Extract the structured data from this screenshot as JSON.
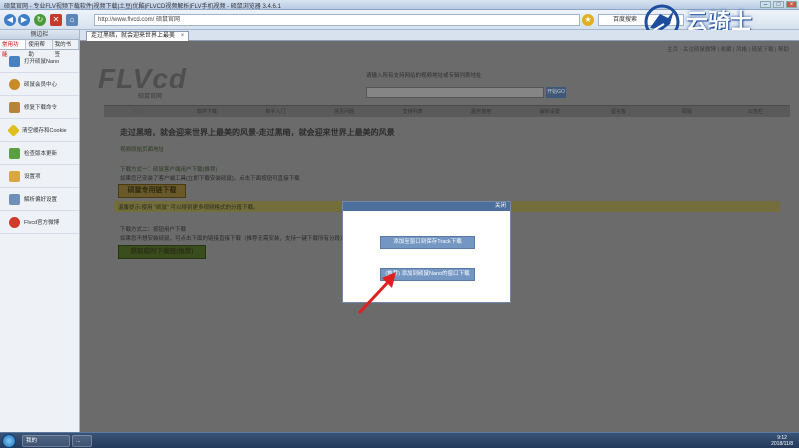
{
  "window": {
    "title": "硕鼠官网 - 专业FLV视频下载软件|视频下载|土豆|优酷|FLVCD视频解析|FLV手机视频 - 硕鼠浏览器 3.4.6.1",
    "controls": [
      "–",
      "□",
      "×"
    ]
  },
  "navbar": {
    "address": "http://www.flvcd.com/ 硕鼠官网",
    "search_label": "百度搜索"
  },
  "brand": {
    "name": "云骑士"
  },
  "sidebar": {
    "header": "侧边栏",
    "tabs": [
      "常用功能",
      "使用帮助",
      "我的书签"
    ],
    "items": [
      {
        "label": "打开硕鼠Nano",
        "color": "#4a7fc1"
      },
      {
        "label": "硕鼠会员中心",
        "color": "#c98a2a"
      },
      {
        "label": "修复下载命令",
        "color": "#b5853a"
      },
      {
        "label": "清空缓存和Cookie",
        "color": "#e0c020"
      },
      {
        "label": "检查版本更新",
        "color": "#5aa040"
      },
      {
        "label": "设置项",
        "color": "#d9a640"
      },
      {
        "label": "解析偏好设置",
        "color": "#6e8fb8"
      },
      {
        "label": "Flvcd官方微博",
        "color": "#d03a2a"
      }
    ]
  },
  "tabs": [
    {
      "label": "走过黑暗，就会迎来世界上最美"
    }
  ],
  "content": {
    "toplinks": "主页 · 关注硕鼠微博 | 收藏 | 风格 | 硕鼠下载 | 帮助",
    "logo_text": "FLVcd",
    "logo_sub": "硕鼠官网",
    "hint": "请输入所有支持网站的视频地址或专辑列表地址",
    "parse_button": "开始GO",
    "menu": [
      "首页",
      "软件下载",
      "新手入门",
      "常见问题",
      "支持列表",
      "服务使用",
      "解析设置",
      "留言板",
      "硕鼠",
      "公告栏"
    ],
    "headline": "走过黑暗，就会迎来世界上最美的风景-走过黑暗，就会迎来世界上最美的风景",
    "original_address_label": "视频原始页面地址",
    "method1_title": "下载方式一：硕鼠客户端用户下载(推荐)",
    "method1_desc": "如果您已安装了客户端工具(立即下载安装硕鼠)，点击下面按钮可直接下载",
    "method1_button": "硕鼠专用链下载",
    "tip": "温馨提示:使用 \"硕鼠\" 可以得到更多视频格式的分段下载。",
    "method2_title": "下载方式二：按钮用户下载",
    "method2_desc": "如果您不想安装硕鼠，可点击下面的链接直接下载（推荐无需安装，支持一键下载所有分段）",
    "method2_button": "获取临时下载链(推荐)"
  },
  "dialog": {
    "title": "关闭",
    "button1": "添加至窗口到保存Track下载",
    "button2": "(推荐) 添加到硕鼠Nano的窗口下载"
  },
  "taskbar": {
    "items": [
      "我的",
      "..."
    ],
    "time": "9:12",
    "date": "2018/11/8"
  }
}
